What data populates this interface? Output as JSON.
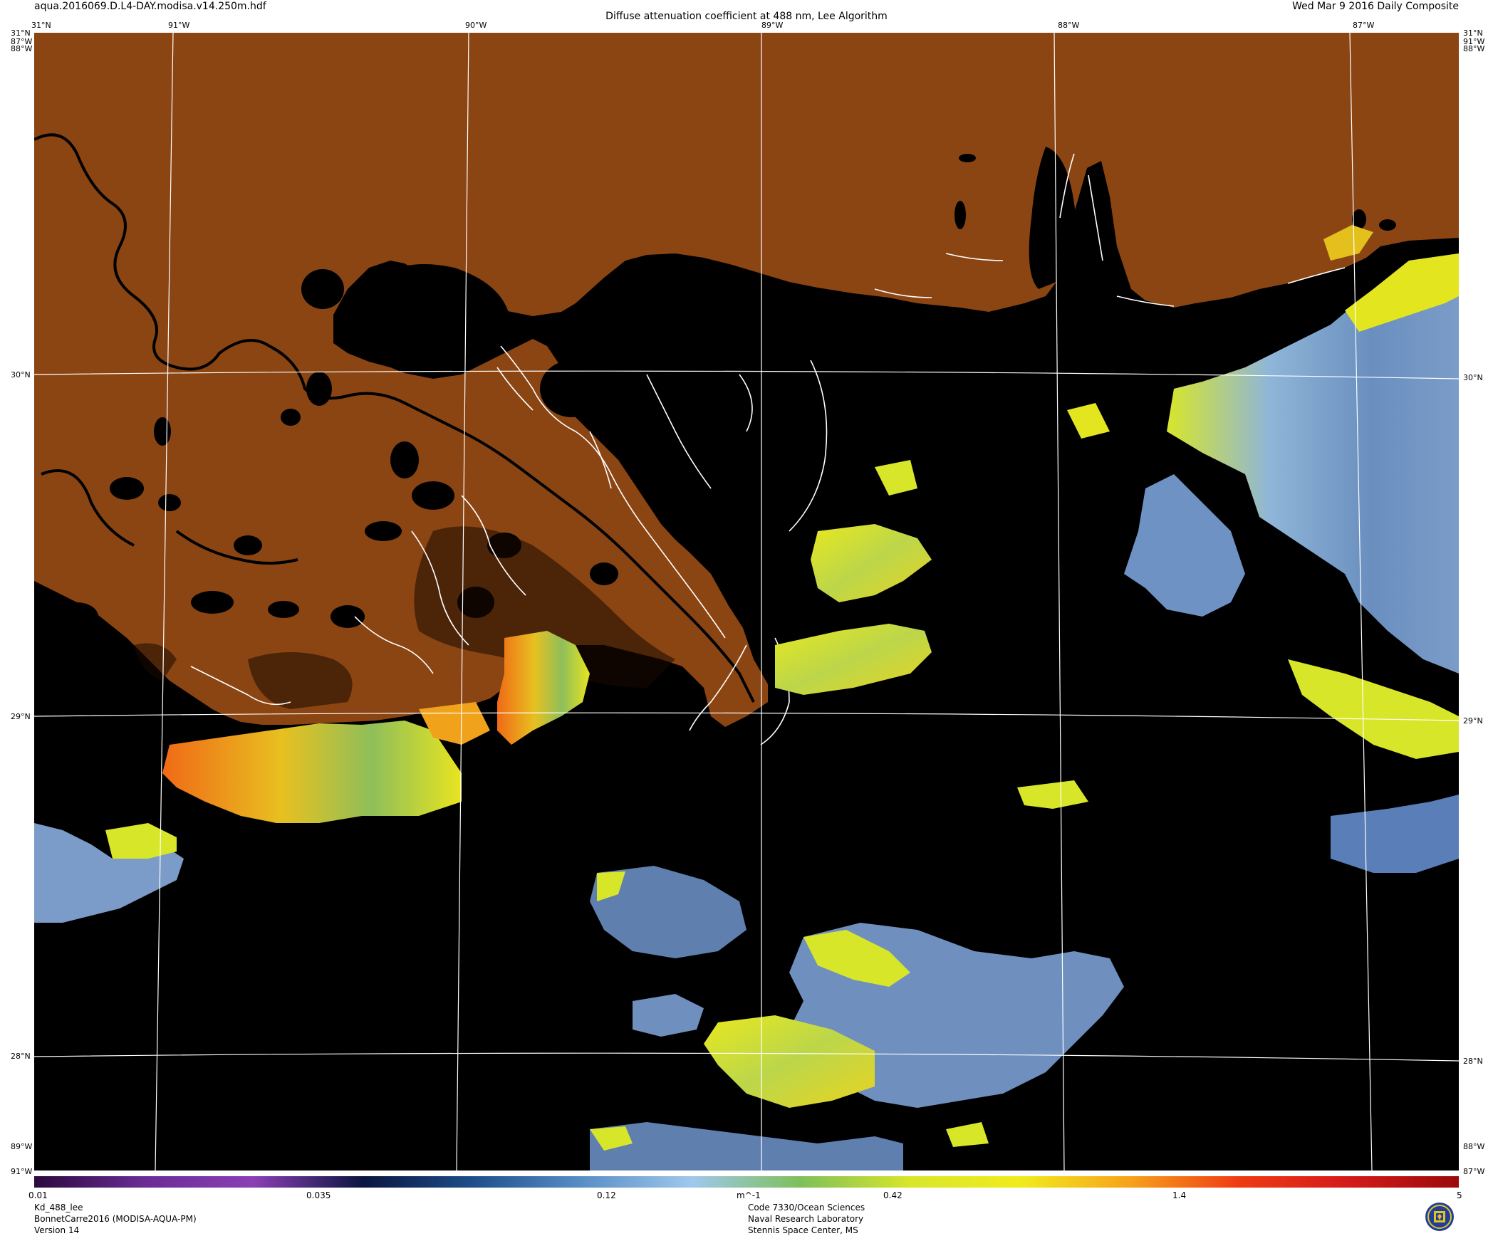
{
  "header": {
    "filename": "aqua.2016069.D.L4-DAY.modisa.v14.250m.hdf",
    "title": "Diffuse attenuation coefficient at 488 nm, Lee Algorithm",
    "date": "Wed Mar  9 2016 Daily Composite"
  },
  "graticule": {
    "top_lon_labels": [
      "91°W",
      "90°W",
      "89°W",
      "88°W",
      "87°W"
    ],
    "lat_labels": [
      "31°N",
      "30°N",
      "29°N",
      "28°N"
    ],
    "corner_labels": {
      "top_left_lat": "31°N",
      "top_left_lon1": "87°W",
      "top_left_lon2": "88°W",
      "top_right_lat": "31°N",
      "top_right_lon1": "91°W",
      "top_right_lon2": "88°W",
      "bottom_left_lon1": "89°W",
      "bottom_left_lon2": "91°W",
      "bottom_right_lon1": "88°W",
      "bottom_right_lon2": "87°W"
    }
  },
  "colorbar": {
    "tick_labels": [
      "0.01",
      "0.035",
      "0.12",
      "m^-1",
      "0.42",
      "1.4",
      "5"
    ],
    "stops": [
      "#2b0a3d",
      "#6a2c95",
      "#8b3fb5",
      "#0a1540",
      "#1e4f8a",
      "#5a8fc6",
      "#9fc8ec",
      "#7fbf5a",
      "#d8e62a",
      "#f0ec1c",
      "#f7a21b",
      "#ef3b14",
      "#d41a1a",
      "#9c0a0a"
    ]
  },
  "footer": {
    "left": [
      "Kd_488_lee",
      "BonnetCarre2016 (MODISA-AQUA-PM)",
      "Version 14"
    ],
    "center": [
      "Code 7330/Ocean Sciences",
      "Naval Research Laboratory",
      "Stennis Space Center, MS"
    ]
  },
  "map_colors": {
    "land": "#8b4513",
    "water": "#000000",
    "graticule": "#ffffff"
  },
  "logo_icon": "nrl-seal-icon"
}
